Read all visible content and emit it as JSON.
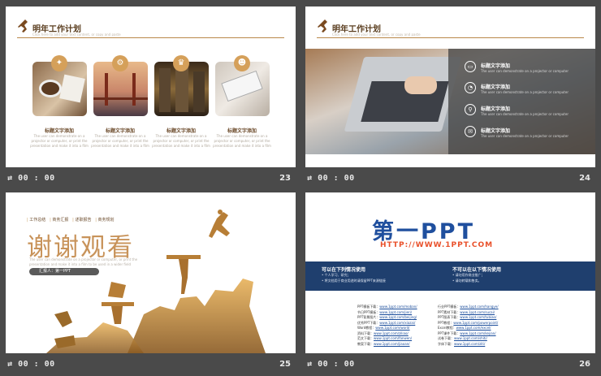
{
  "footer_time": "00 : 00",
  "slides": [
    {
      "number": "23",
      "title": "明年工作计划",
      "subtitle": "Click here to add your text content, or copy and paste",
      "cards": [
        {
          "badge_icon": "lightbulb-icon",
          "badge_glyph": "✦",
          "title": "标题文字添加",
          "desc": "The user can demonstrate on a projector or computer, or print the presentation and make it into a film"
        },
        {
          "badge_icon": "gear-icon",
          "badge_glyph": "⚙",
          "title": "标题文字添加",
          "desc": "The user can demonstrate on a projector or computer, or print the presentation and make it into a film"
        },
        {
          "badge_icon": "trophy-icon",
          "badge_glyph": "♛",
          "title": "标题文字添加",
          "desc": "The user can demonstrate on a projector or computer, or print the presentation and make it into a film"
        },
        {
          "badge_icon": "people-icon",
          "badge_glyph": "☻",
          "title": "标题文字添加",
          "desc": "The user can demonstrate on a projector or computer, or print the presentation and make it into a film"
        }
      ]
    },
    {
      "number": "24",
      "title": "明年工作计划",
      "subtitle": "Click here to add your text content, or copy and paste",
      "items": [
        {
          "icon": "monitor-icon",
          "glyph": "▭",
          "title": "标题文字添加",
          "desc": "The user can demonstrate on a projector or computer"
        },
        {
          "icon": "chart-icon",
          "glyph": "◔",
          "title": "标题文字添加",
          "desc": "The user can demonstrate on a projector or computer"
        },
        {
          "icon": "location-icon",
          "glyph": "⚲",
          "title": "标题文字添加",
          "desc": "The user can demonstrate on a projector or computer"
        },
        {
          "icon": "chat-icon",
          "glyph": "✉",
          "title": "标题文字添加",
          "desc": "The user can demonstrate on a projector or computer"
        }
      ]
    },
    {
      "number": "25",
      "tags": [
        "工作总结",
        "商务汇报",
        "述职报告",
        "商务规划"
      ],
      "big_title": "谢谢观看",
      "desc": "The user can demonstrate on a projector or computer, or print the presentation and make it into a film to be used in a wider field",
      "presenter": "汇报人：第一PPT"
    },
    {
      "number": "26",
      "logo_cn": "第一PPT",
      "url": "HTTP://WWW.1PPT.COM",
      "can_title": "可以在下列情况使用",
      "can_items": [
        "• 个人学习、研究；",
        "• 将文档用于商业用途时请保留PPT来源链接"
      ],
      "cannot_title": "不可以在以下情况使用",
      "cannot_items": [
        "• 请勿用作商业推广；",
        "• 请勿转载和售卖。"
      ],
      "links_left": [
        {
          "k": "PPT模板下载：",
          "v": "www.1ppt.com/moban/"
        },
        {
          "k": "节日PPT模板：",
          "v": "www.1ppt.com/jieri/"
        },
        {
          "k": "PPT背景图片：",
          "v": "www.1ppt.com/beijing/"
        },
        {
          "k": "优秀PPT下载：",
          "v": "www.1ppt.com/xiazai/"
        },
        {
          "k": "Word教程：",
          "v": "www.1ppt.com/word/"
        },
        {
          "k": "资料下载：",
          "v": "www.1ppt.com/ziliao/"
        },
        {
          "k": "范文下载：",
          "v": "www.1ppt.com/fanwen/"
        },
        {
          "k": "教案下载：",
          "v": "www.1ppt.com/jiaoan/"
        }
      ],
      "links_right": [
        {
          "k": "行业PPT模板：",
          "v": "www.1ppt.com/hangye/"
        },
        {
          "k": "PPT素材下载：",
          "v": "www.1ppt.com/sucai/"
        },
        {
          "k": "PPT图表下载：",
          "v": "www.1ppt.com/tubiao/"
        },
        {
          "k": "PPT教程：",
          "v": "www.1ppt.com/powerpoint/"
        },
        {
          "k": "Excel教程：",
          "v": "www.1ppt.com/excel/"
        },
        {
          "k": "PPT课件下载：",
          "v": "www.1ppt.com/kejian/"
        },
        {
          "k": "试卷下载：",
          "v": "www.1ppt.com/shiti/"
        },
        {
          "k": "字体下载：",
          "v": "www.1ppt.com/ziti/"
        }
      ]
    }
  ]
}
